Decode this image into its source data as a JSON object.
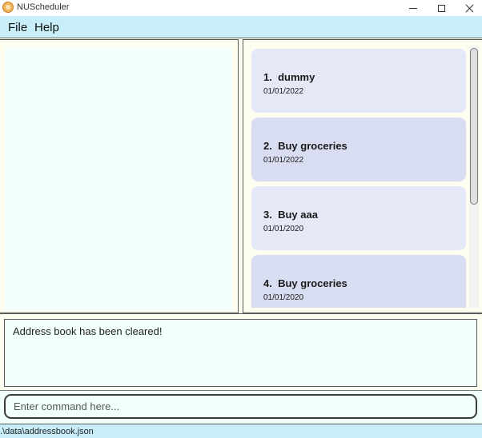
{
  "window": {
    "title": "NUScheduler",
    "app_icon": "app-logo-icon",
    "controls": [
      "minimize-icon",
      "maximize-icon",
      "close-icon"
    ]
  },
  "menu": {
    "file_label": "File",
    "help_label": "Help"
  },
  "event_list": {
    "items": [
      {
        "index": "1.",
        "name": "dummy",
        "date": "01/01/2022"
      },
      {
        "index": "2.",
        "name": "Buy groceries",
        "date": "01/01/2022"
      },
      {
        "index": "3.",
        "name": "Buy aaa",
        "date": "01/01/2020"
      },
      {
        "index": "4.",
        "name": "Buy groceries",
        "date": "01/01/2020"
      }
    ]
  },
  "result": {
    "message": "Address book has been cleared!"
  },
  "command": {
    "placeholder": "Enter command here...",
    "value": ""
  },
  "status": {
    "file_path": ".\\data\\addressbook.json"
  },
  "colors": {
    "menu_bg": "#c8eef9",
    "panel_bg": "#f1fffd",
    "card_odd": "#e5e8f7",
    "card_even": "#d8ddf1"
  }
}
